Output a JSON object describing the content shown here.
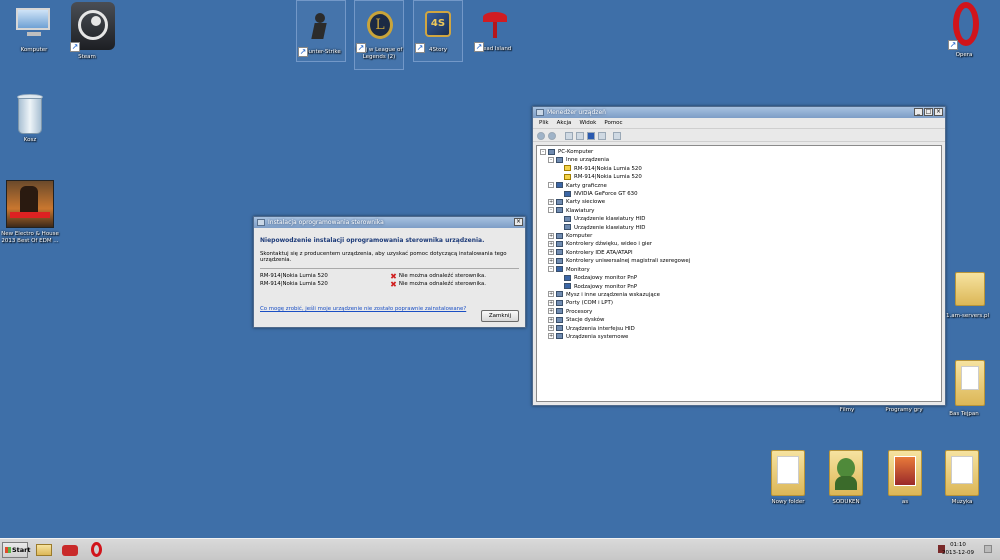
{
  "desktop_icons": [
    {
      "label": "Komputer",
      "icon": "computer-icon"
    },
    {
      "label": "Steam",
      "icon": "steam-icon"
    },
    {
      "label": "Counter-Strike",
      "icon": "counter-strike-icon"
    },
    {
      "label": "Graj w League of Legends (2)",
      "icon": "league-of-legends-icon"
    },
    {
      "label": "4Story",
      "icon": "4story-icon"
    },
    {
      "label": "Dead Island",
      "icon": "dead-island-icon"
    },
    {
      "label": "Opera",
      "icon": "opera-icon"
    },
    {
      "label": "Kosz",
      "icon": "recycle-bin-icon"
    },
    {
      "label": "New Electro & House 2013 Best Of EDM ...",
      "icon": "album-cover-icon"
    },
    {
      "label": "Filmy",
      "icon": "folder-icon"
    },
    {
      "label": "Programy gry",
      "icon": "folder-icon"
    },
    {
      "label": "Bas Tejpan",
      "icon": "folder-icon"
    },
    {
      "label": "Nowy folder",
      "icon": "folder-icon"
    },
    {
      "label": "SODUKEN",
      "icon": "folder-icon"
    },
    {
      "label": "as",
      "icon": "folder-icon"
    },
    {
      "label": "Muzyka",
      "icon": "folder-icon"
    },
    {
      "label": "1.am-servers.pl",
      "icon": "folder-icon"
    }
  ],
  "device_manager": {
    "title": "Menedżer urządzeń",
    "menu": [
      "Plik",
      "Akcja",
      "Widok",
      "Pomoc"
    ],
    "tree": [
      {
        "label": "PC-Komputer",
        "level": 0,
        "exp": "-",
        "icon": "computer"
      },
      {
        "label": "Inne urządzenia",
        "level": 1,
        "exp": "-",
        "icon": "folder"
      },
      {
        "label": "RM-914|Nokia Lumia 520",
        "level": 2,
        "exp": "",
        "icon": "warn"
      },
      {
        "label": "RM-914|Nokia Lumia 520",
        "level": 2,
        "exp": "",
        "icon": "warn"
      },
      {
        "label": "Karty graficzne",
        "level": 1,
        "exp": "-",
        "icon": "disp"
      },
      {
        "label": "NVIDIA GeForce GT 630",
        "level": 2,
        "exp": "",
        "icon": "disp"
      },
      {
        "label": "Karty sieciowe",
        "level": 1,
        "exp": "+",
        "icon": "device"
      },
      {
        "label": "Klawiatury",
        "level": 1,
        "exp": "-",
        "icon": "device"
      },
      {
        "label": "Urządzenie klawiatury HID",
        "level": 2,
        "exp": "",
        "icon": "device"
      },
      {
        "label": "Urządzenie klawiatury HID",
        "level": 2,
        "exp": "",
        "icon": "device"
      },
      {
        "label": "Komputer",
        "level": 1,
        "exp": "+",
        "icon": "device"
      },
      {
        "label": "Kontrolery dźwięku, wideo i gier",
        "level": 1,
        "exp": "+",
        "icon": "device"
      },
      {
        "label": "Kontrolery IDE ATA/ATAPI",
        "level": 1,
        "exp": "+",
        "icon": "device"
      },
      {
        "label": "Kontrolery uniwersalnej magistrali szeregowej",
        "level": 1,
        "exp": "+",
        "icon": "device"
      },
      {
        "label": "Monitory",
        "level": 1,
        "exp": "-",
        "icon": "disp"
      },
      {
        "label": "Rodzajowy monitor PnP",
        "level": 2,
        "exp": "",
        "icon": "disp"
      },
      {
        "label": "Rodzajowy monitor PnP",
        "level": 2,
        "exp": "",
        "icon": "disp"
      },
      {
        "label": "Mysz i inne urządzenia wskazujące",
        "level": 1,
        "exp": "+",
        "icon": "device"
      },
      {
        "label": "Porty (COM i LPT)",
        "level": 1,
        "exp": "+",
        "icon": "device"
      },
      {
        "label": "Procesory",
        "level": 1,
        "exp": "+",
        "icon": "device"
      },
      {
        "label": "Stacje dysków",
        "level": 1,
        "exp": "+",
        "icon": "device"
      },
      {
        "label": "Urządzenia interfejsu HID",
        "level": 1,
        "exp": "+",
        "icon": "device"
      },
      {
        "label": "Urządzenia systemowe",
        "level": 1,
        "exp": "+",
        "icon": "device"
      }
    ]
  },
  "driver_dialog": {
    "title": "Instalacja oprogramowania sterownika",
    "heading": "Niepowodzenie instalacji oprogramowania sterownika urządzenia.",
    "info": "Skontaktuj się z producentem urządzenia, aby uzyskać pomoc dotyczącą instalowania tego urządzenia.",
    "rows": [
      {
        "device": "RM-914|Nokia Lumia 520",
        "status": "Nie można odnaleźć sterownika."
      },
      {
        "device": "RM-914|Nokia Lumia 520",
        "status": "Nie można odnaleźć sterownika."
      }
    ],
    "link": "Co mogę zrobić, jeśli moje urządzenie nie zostało poprawnie zainstalowane?",
    "close_label": "Zamknij"
  },
  "taskbar": {
    "start_label": "Start",
    "time": "01:10",
    "date": "2013-12-09"
  },
  "colors": {
    "desktop": "#3e6fa8",
    "error": "#d02020",
    "link": "#1a4fc4"
  }
}
